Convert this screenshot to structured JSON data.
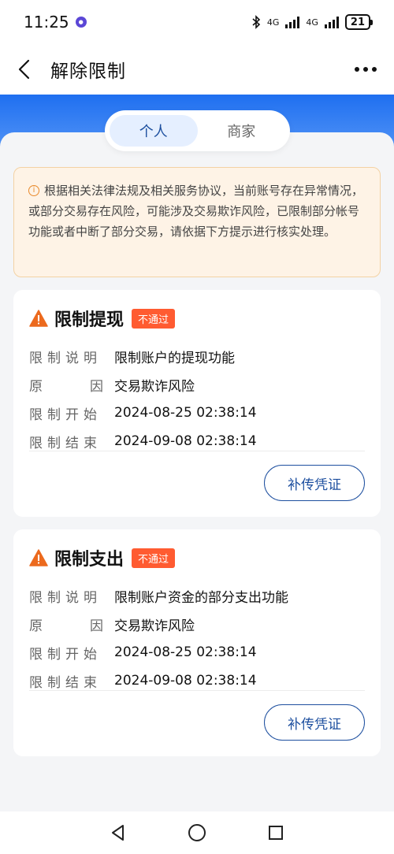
{
  "status_bar": {
    "time": "11:25",
    "network_1": "4G",
    "network_2": "4G",
    "battery": "21"
  },
  "nav": {
    "title": "解除限制"
  },
  "tabs": [
    {
      "label": "个人",
      "active": true
    },
    {
      "label": "商家",
      "active": false
    }
  ],
  "notice": {
    "text": "根据相关法律法规及相关服务协议，当前账号存在异常情况，或部分交易存在风险，可能涉及交易欺诈风险，已限制部分帐号功能或者中断了部分交易，请依据下方提示进行核实处理。"
  },
  "cards": [
    {
      "title": "限制提现",
      "badge": "不通过",
      "rows": [
        {
          "label": "限制说明",
          "value": "限制账户的提现功能"
        },
        {
          "label_a": "原",
          "label_b": "因",
          "value": "交易欺诈风险"
        },
        {
          "label": "限制开始",
          "value": "2024-08-25 02:38:14"
        },
        {
          "label": "限制结束",
          "value": "2024-09-08 02:38:14"
        }
      ],
      "button": "补传凭证"
    },
    {
      "title": "限制支出",
      "badge": "不通过",
      "rows": [
        {
          "label": "限制说明",
          "value": "限制账户资金的部分支出功能"
        },
        {
          "label_a": "原",
          "label_b": "因",
          "value": "交易欺诈风险"
        },
        {
          "label": "限制开始",
          "value": "2024-08-25 02:38:14"
        },
        {
          "label": "限制结束",
          "value": "2024-09-08 02:38:14"
        }
      ],
      "button": "补传凭证"
    }
  ],
  "colors": {
    "brand_blue": "#1f6ff0",
    "badge_red": "#ff5b31",
    "warn_orange": "#e8892b",
    "button_blue": "#1d4f9f"
  }
}
